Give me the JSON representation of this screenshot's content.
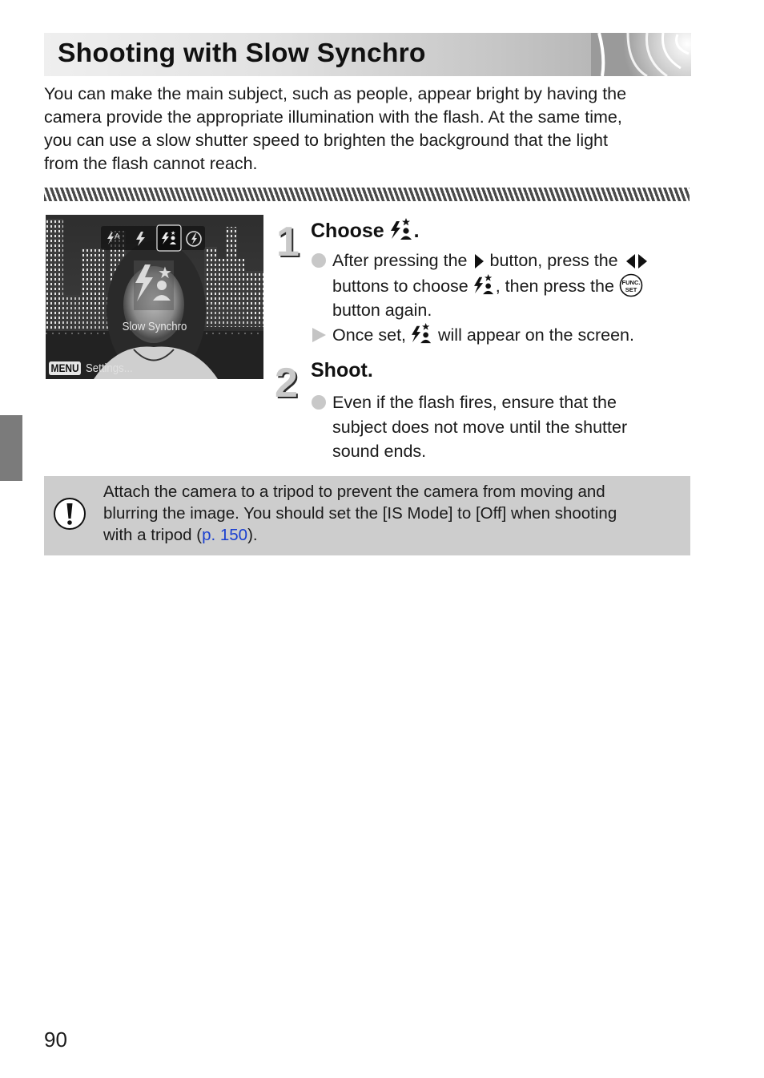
{
  "header": {
    "title": "Shooting with Slow Synchro"
  },
  "intro": {
    "text": "You can make the main subject, such as people, appear bright by having the camera provide the appropriate illumination with the flash. At the same time, you can use a slow shutter speed to brighten the background that the light from the flash cannot reach.",
    "lines": [
      "You can make the main subject, such as people, appear bright by having the",
      "camera provide the appropriate illumination with the flash. At the same time,",
      "you can use a slow shutter speed to brighten the background that the light",
      "from the flash cannot reach."
    ]
  },
  "camera_screen": {
    "flash_modes": [
      {
        "icon": "flash-auto-icon",
        "label": "Auto"
      },
      {
        "icon": "flash-on-icon",
        "label": "On"
      },
      {
        "icon": "slow-synchro-icon",
        "label": "Slow Synchro",
        "selected": true
      },
      {
        "icon": "flash-off-icon",
        "label": "Off"
      }
    ],
    "selected_label": "Slow Synchro",
    "menu_button": "MENU",
    "menu_text": "Settings..."
  },
  "steps": [
    {
      "number": "1",
      "title_prefix": "Choose",
      "title_icon": "slow-synchro-icon",
      "title_suffix": ".",
      "items": [
        {
          "type": "bullet",
          "segments": [
            {
              "text": "After pressing the "
            },
            {
              "icon": "right-arrow-button-icon"
            },
            {
              "text": " button, press the "
            },
            {
              "icon": "left-right-arrow-buttons-icon"
            },
            {
              "text": " buttons to choose "
            },
            {
              "icon": "slow-synchro-icon"
            },
            {
              "text": ", then press the "
            },
            {
              "icon": "func-set-button-icon"
            },
            {
              "text": " button again."
            }
          ],
          "lines": [
            "After pressing the",
            "button, press the",
            "buttons to choose",
            ", then press the",
            "button again."
          ]
        },
        {
          "type": "result",
          "segments": [
            {
              "text": "Once set, "
            },
            {
              "icon": "slow-synchro-icon"
            },
            {
              "text": " will appear on the screen."
            }
          ],
          "lines": [
            "Once set,",
            "will appear on the screen."
          ]
        }
      ]
    },
    {
      "number": "2",
      "title": "Shoot.",
      "items": [
        {
          "type": "bullet",
          "lines": [
            "Even if the flash fires, ensure that the",
            "subject does not move until the shutter",
            "sound ends."
          ]
        }
      ]
    }
  ],
  "caution": {
    "icon": "caution-icon",
    "line1": "Attach the camera to a tripod to prevent the camera from moving and",
    "line2": "blurring the image. You should set the [IS Mode] to [Off] when shooting",
    "line3_prefix": "with a tripod (",
    "link_text": "p. 150",
    "line3_suffix": ").",
    "link_color": "#1a3fd0"
  },
  "func_set": {
    "top": "FUNC.",
    "bottom": "SET"
  },
  "page_number": "90"
}
